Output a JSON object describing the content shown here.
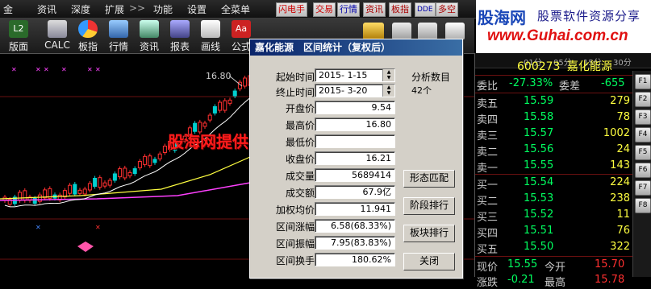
{
  "menu": {
    "items": [
      "金",
      "资讯",
      "深度",
      "扩展",
      "功能",
      "设置",
      "全菜单"
    ],
    "extend_arrow": ">>",
    "quick_buttons": [
      "闪电手",
      "交易",
      "行情",
      "资讯",
      "板指",
      "DDE",
      "多空"
    ]
  },
  "logo": {
    "name": "股海网",
    "slogan": "股票软件资源分享",
    "url": "www.Guhai.com.cn"
  },
  "toolbar": {
    "items": [
      {
        "label": "版面",
        "icon": "layout-icon"
      },
      {
        "label": "CALC",
        "icon": "calculator-icon"
      },
      {
        "label": "板指",
        "icon": "sector-index-icon"
      },
      {
        "label": "行情",
        "icon": "quotes-icon"
      },
      {
        "label": "资讯",
        "icon": "news-icon"
      },
      {
        "label": "报表",
        "icon": "report-icon"
      },
      {
        "label": "画线",
        "icon": "draw-line-icon"
      },
      {
        "label": "公式",
        "icon": "formula-icon"
      }
    ]
  },
  "chart": {
    "high_label": "16.80",
    "colors": {
      "up": "#ff3030",
      "down": "#00d0d0",
      "ma_short": "#ffffff",
      "ma_mid": "#ffff40",
      "ma_long": "#ff40ff"
    }
  },
  "watermark": "股海网提供 Www.Guhai.Com.CN",
  "dialog": {
    "title": "嘉化能源　区间统计（复权后）",
    "analysis_label": "分析数目",
    "analysis_count": "42个",
    "start_label": "起始时间",
    "start_value": "2015- 1-15",
    "end_label": "终止时间",
    "end_value": "2015- 3-20",
    "rows": [
      {
        "label": "开盘价",
        "value": "9.54"
      },
      {
        "label": "最高价",
        "value": "16.80"
      },
      {
        "label": "最低价",
        "value": ""
      },
      {
        "label": "收盘价",
        "value": "16.21"
      },
      {
        "label": "成交量",
        "value": "5689414"
      },
      {
        "label": "成交额",
        "value": "67.9亿"
      },
      {
        "label": "加权均价",
        "value": "11.941"
      },
      {
        "label": "区间涨幅",
        "value": "6.58(68.33%)"
      },
      {
        "label": "区间振幅",
        "value": "7.95(83.83%)"
      },
      {
        "label": "区间换手",
        "value": "180.62%"
      }
    ],
    "buttons": [
      "形态匹配",
      "阶段排行",
      "板块排行",
      "关闭"
    ]
  },
  "right_panel": {
    "tabs": [
      "01分",
      "05分",
      "15分",
      "30分"
    ],
    "stock_code": "600273",
    "stock_name": "嘉化能源",
    "weibi_label": "委比",
    "weibi_value": "-27.33%",
    "weicha_label": "委差",
    "weicha_value": "-655",
    "sells": [
      {
        "label": "卖五",
        "price": "15.59",
        "vol": "279"
      },
      {
        "label": "卖四",
        "price": "15.58",
        "vol": "78"
      },
      {
        "label": "卖三",
        "price": "15.57",
        "vol": "1002"
      },
      {
        "label": "卖二",
        "price": "15.56",
        "vol": "24"
      },
      {
        "label": "卖一",
        "price": "15.55",
        "vol": "143"
      }
    ],
    "buys": [
      {
        "label": "买一",
        "price": "15.54",
        "vol": "224"
      },
      {
        "label": "买二",
        "price": "15.53",
        "vol": "238"
      },
      {
        "label": "买三",
        "price": "15.52",
        "vol": "11"
      },
      {
        "label": "买四",
        "price": "15.51",
        "vol": "76"
      },
      {
        "label": "买五",
        "price": "15.50",
        "vol": "322"
      }
    ],
    "current_label": "现价",
    "current_value": "15.55",
    "today_open_label": "今开",
    "today_open_value": "15.70",
    "change_label": "涨跌",
    "change_value": "-0.21",
    "high_label": "最高",
    "high_value": "15.78",
    "side_icons": [
      "F1",
      "F2",
      "F3",
      "F4",
      "F5",
      "F6",
      "F7",
      "F8"
    ]
  }
}
